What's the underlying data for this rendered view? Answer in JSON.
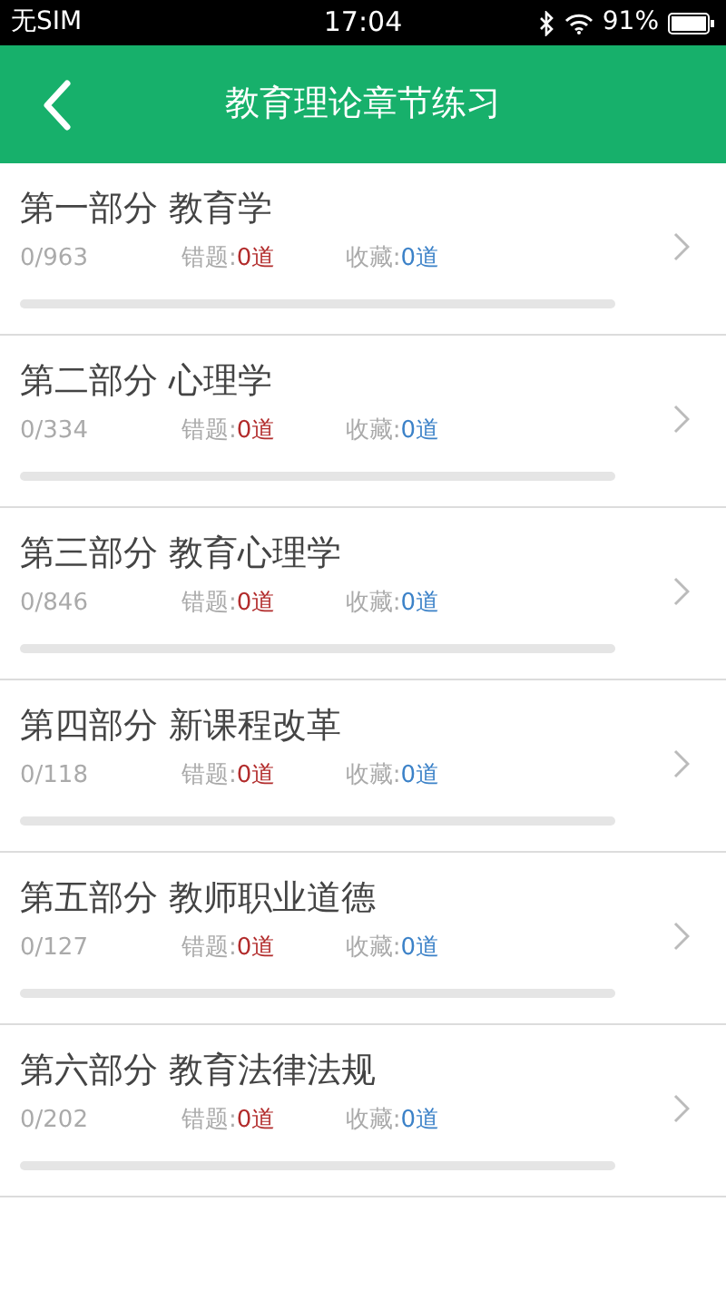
{
  "status_bar": {
    "carrier": "无SIM",
    "time": "17:04",
    "battery": "91%"
  },
  "header": {
    "title": "教育理论章节练习"
  },
  "chapters": [
    {
      "title": "第一部分 教育学",
      "progress": "0/963",
      "wrong_label": "错题:",
      "wrong_count": "0道",
      "fav_label": "收藏:",
      "fav_count": "0道",
      "level": 0
    },
    {
      "title": "第二部分 心理学",
      "progress": "0/334",
      "wrong_label": "错题:",
      "wrong_count": "0道",
      "fav_label": "收藏:",
      "fav_count": "0道",
      "level": 0
    },
    {
      "title": "第三部分 教育心理学",
      "progress": "0/846",
      "wrong_label": "错题:",
      "wrong_count": "0道",
      "fav_label": "收藏:",
      "fav_count": "0道",
      "level": 0
    },
    {
      "title": "第四部分 新课程改革",
      "progress": "0/118",
      "wrong_label": "错题:",
      "wrong_count": "0道",
      "fav_label": "收藏:",
      "fav_count": "0道",
      "level": 0
    },
    {
      "title": "第五部分 教师职业道德",
      "progress": "0/127",
      "wrong_label": "错题:",
      "wrong_count": "0道",
      "fav_label": "收藏:",
      "fav_count": "0道",
      "level": 0
    },
    {
      "title": "第六部分 教育法律法规",
      "progress": "0/202",
      "wrong_label": "错题:",
      "wrong_count": "0道",
      "fav_label": "收藏:",
      "fav_count": "0道",
      "level": 0
    }
  ]
}
